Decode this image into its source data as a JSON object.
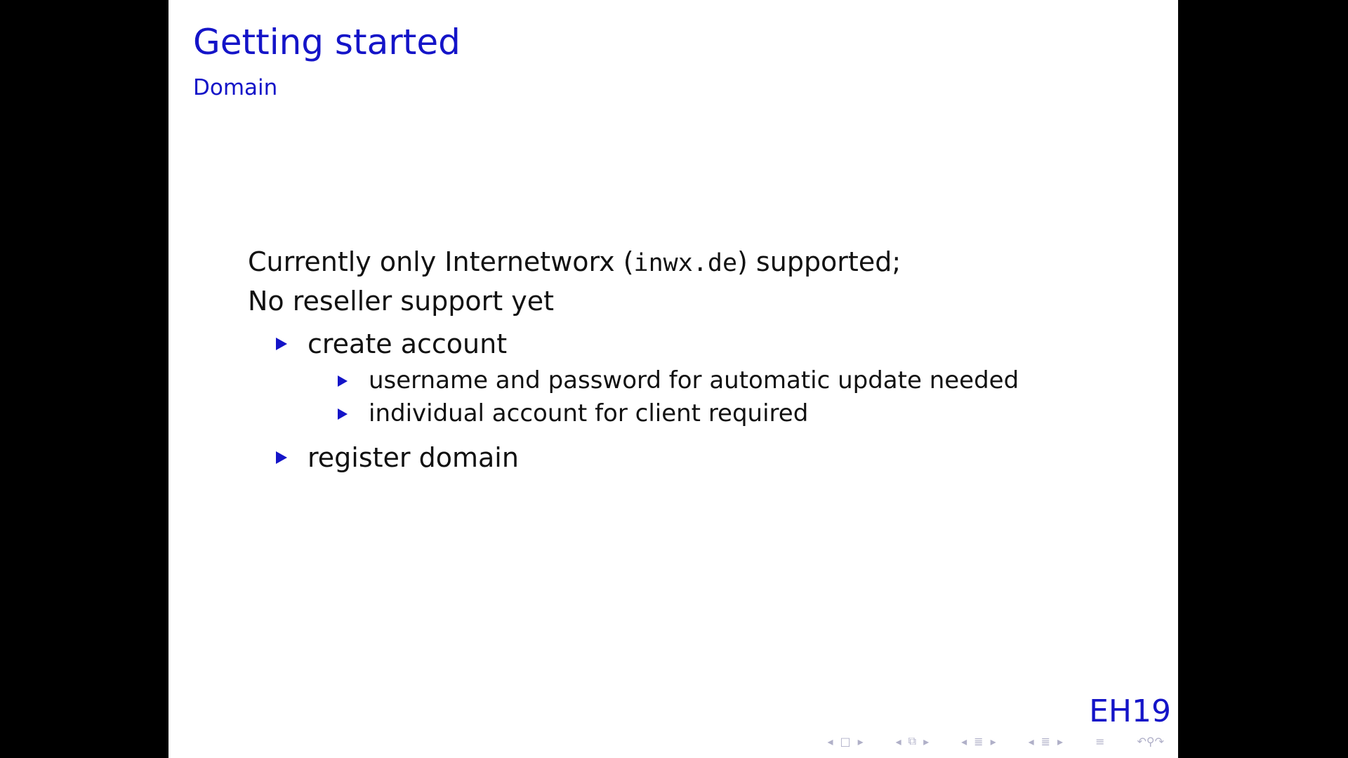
{
  "slide": {
    "title": "Getting started",
    "subtitle": "Domain",
    "intro_line1_before": "Currently only Internetworx (",
    "intro_line1_code": "inwx.de",
    "intro_line1_after": ") supported;",
    "intro_line2": "No reseller support yet",
    "items": [
      {
        "label": "create account",
        "subitems": [
          "username and password for automatic update needed",
          "individual account for client required"
        ]
      },
      {
        "label": "register domain"
      }
    ],
    "footer_label": "EH19"
  },
  "colors": {
    "accent": "#1414c8",
    "text": "#111111",
    "background": "#ffffff",
    "letterbox": "#000000"
  },
  "nav_icons": [
    "nav-first-icon",
    "nav-frame-icon",
    "nav-section-icon",
    "nav-subsection-icon",
    "nav-align-icon",
    "nav-search-icon"
  ]
}
